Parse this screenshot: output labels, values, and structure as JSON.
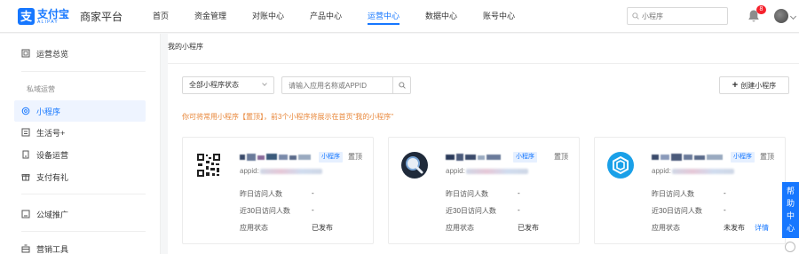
{
  "brand": {
    "logo_char": "支",
    "name_cn": "支付宝",
    "name_en": "ALIPAY",
    "product": "商家平台"
  },
  "nav": [
    {
      "label": "首页"
    },
    {
      "label": "资金管理"
    },
    {
      "label": "对账中心"
    },
    {
      "label": "产品中心"
    },
    {
      "label": "运营中心",
      "active": true
    },
    {
      "label": "数据中心"
    },
    {
      "label": "账号中心"
    }
  ],
  "header": {
    "search_placeholder": "小程序",
    "notification_count": "8"
  },
  "sidebar": {
    "items": [
      {
        "label": "运营总览",
        "icon": "overview-icon"
      },
      {
        "label": "小程序",
        "icon": "mini-program-icon",
        "active": true
      },
      {
        "label": "生活号+",
        "icon": "life-account-icon"
      },
      {
        "label": "设备运营",
        "icon": "device-icon"
      },
      {
        "label": "支付有礼",
        "icon": "gift-icon"
      },
      {
        "label": "公域推广",
        "icon": "promotion-icon"
      },
      {
        "label": "营销工具",
        "icon": "marketing-tools-icon"
      }
    ],
    "group_label": "私域运营"
  },
  "main": {
    "breadcrumb": "我的小程序",
    "status_filter": "全部小程序状态",
    "search_placeholder": "请输入应用名称或APPID",
    "create_label": "创建小程序",
    "tip": "你可将常用小程序【置顶】，前3个小程序将展示在首页\"我的小程序\""
  },
  "cards": [
    {
      "tag": "小程序",
      "pin": "置顶",
      "appid_label": "appid:",
      "rows": [
        {
          "label": "昨日访问人数",
          "value": "-"
        },
        {
          "label": "近30日访问人数",
          "value": "-"
        },
        {
          "label": "应用状态",
          "value": "已发布"
        }
      ],
      "detail": ""
    },
    {
      "tag": "小程序",
      "pin": "置顶",
      "appid_label": "appid:",
      "rows": [
        {
          "label": "昨日访问人数",
          "value": "-"
        },
        {
          "label": "近30日访问人数",
          "value": "-"
        },
        {
          "label": "应用状态",
          "value": "已发布"
        }
      ],
      "detail": ""
    },
    {
      "tag": "小程序",
      "pin": "置顶",
      "appid_label": "appid:",
      "rows": [
        {
          "label": "昨日访问人数",
          "value": "-"
        },
        {
          "label": "近30日访问人数",
          "value": "-"
        },
        {
          "label": "应用状态",
          "value": "未发布"
        }
      ],
      "detail": "详情"
    }
  ],
  "help": [
    "帮",
    "助",
    "中",
    "心"
  ],
  "colors": {
    "accent": "#1677ff",
    "tip": "#e8873a",
    "badge": "#f5222d"
  }
}
